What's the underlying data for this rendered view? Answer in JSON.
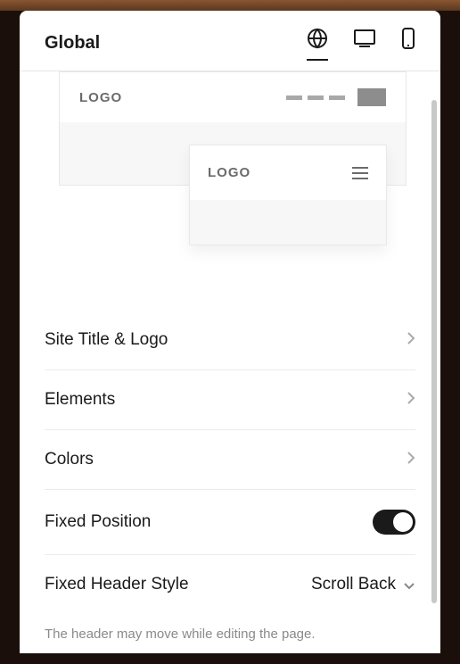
{
  "header": {
    "title": "Global"
  },
  "preview": {
    "logo_text": "LOGO"
  },
  "settings": {
    "site_title_logo": "Site Title & Logo",
    "elements": "Elements",
    "colors": "Colors",
    "fixed_position": "Fixed Position",
    "fixed_header_style": {
      "label": "Fixed Header Style",
      "value": "Scroll Back"
    }
  },
  "helper": "The header may move while editing the page."
}
